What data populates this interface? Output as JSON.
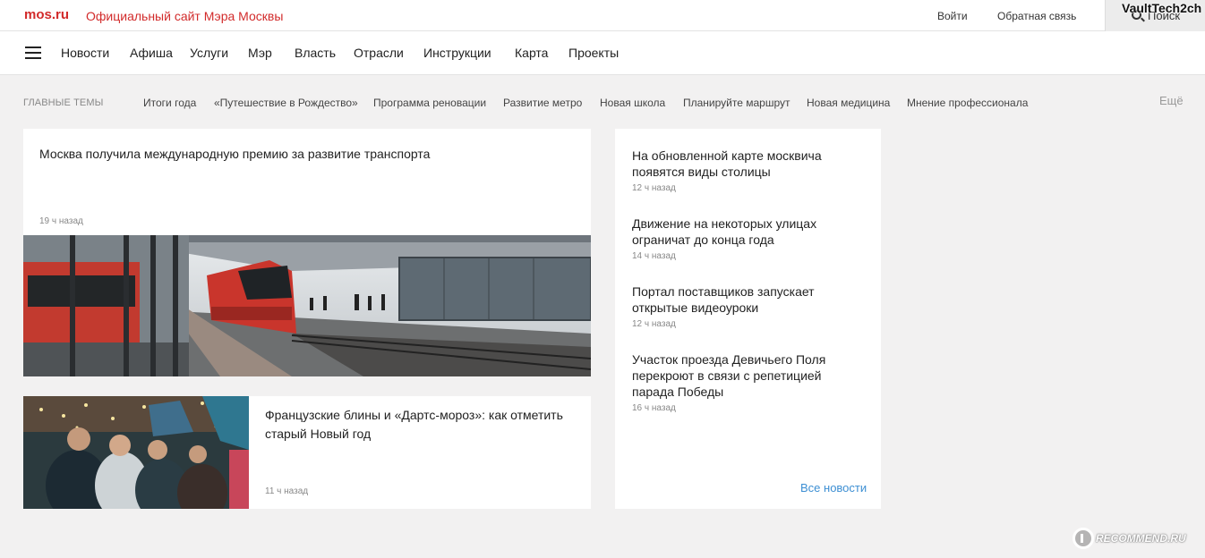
{
  "header": {
    "logo": "mos.ru",
    "subtitle": "Официальный сайт Мэра Москвы",
    "login": "Войти",
    "feedback": "Обратная связь",
    "search": "Поиск",
    "watermark": "VaultTech2ch"
  },
  "nav": {
    "items": [
      "Новости",
      "Афиша",
      "Услуги",
      "Мэр",
      "Власть",
      "Отрасли",
      "Инструкции",
      "Карта",
      "Проекты"
    ]
  },
  "topics": {
    "label": "ГЛАВНЫЕ ТЕМЫ",
    "items": [
      "Итоги года",
      "«Путешествие в Рождество»",
      "Программа реновации",
      "Развитие метро",
      "Новая школа",
      "Планируйте маршрут",
      "Новая медицина",
      "Мнение профессионала"
    ],
    "more": "Ещё"
  },
  "main_news": {
    "title": "Москва получила международную премию за развитие транспорта",
    "time": "19 ч назад"
  },
  "second_news": {
    "title": "Французские блины и «Дартс-мороз»: как отметить старый Новый год",
    "time": "11 ч назад"
  },
  "side_news": {
    "items": [
      {
        "title": "На обновленной карте москвича появятся виды столицы",
        "time": "12 ч назад"
      },
      {
        "title": "Движение на некоторых улицах ограничат до конца года",
        "time": "14 ч назад"
      },
      {
        "title": "Портал поставщиков запускает открытые видеоуроки",
        "time": "12 ч назад"
      },
      {
        "title": "Участок проезда Девичьего Поля перекроют в связи с репетицией парада Победы",
        "time": "16 ч назад"
      }
    ],
    "all_link": "Все новости"
  },
  "badge": {
    "text": "RECOMMEND.RU"
  }
}
